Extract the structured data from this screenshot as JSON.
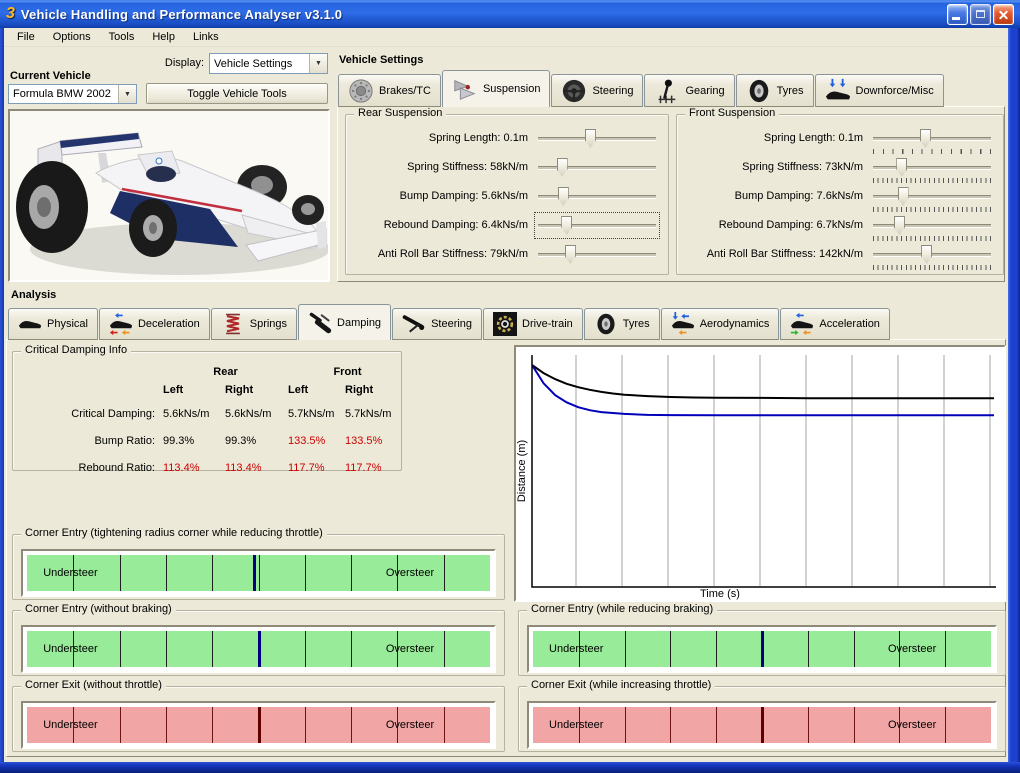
{
  "window": {
    "title": "Vehicle Handling and Performance Analyser v3.1.0",
    "icon_glyph": "3"
  },
  "menu": {
    "items": [
      "File",
      "Options",
      "Tools",
      "Help",
      "Links"
    ]
  },
  "icons": {
    "combo_chevron": "▼"
  },
  "toolbar": {
    "display_label": "Display:",
    "display_value": "Vehicle Settings"
  },
  "current_vehicle": {
    "label": "Current Vehicle",
    "value": "Formula BMW 2002",
    "toggle_button_label": "Toggle Vehicle Tools"
  },
  "vehicle_settings": {
    "section_label": "Vehicle Settings",
    "tabs": [
      {
        "label": "Brakes/TC",
        "icon": "brake-disc-icon",
        "selected": false
      },
      {
        "label": "Suspension",
        "icon": "suspension-icon",
        "selected": true
      },
      {
        "label": "Steering",
        "icon": "steering-wheel-icon",
        "selected": false
      },
      {
        "label": "Gearing",
        "icon": "gear-shifter-icon",
        "selected": false
      },
      {
        "label": "Tyres",
        "icon": "tyre-icon",
        "selected": false
      },
      {
        "label": "Downforce/Misc",
        "icon": "downforce-arrows-icon",
        "selected": false
      }
    ],
    "rear_suspension": {
      "title": "Rear Suspension",
      "sliders": [
        {
          "label": "Spring Length: 0.1m",
          "pct": 44,
          "ticks": 0,
          "focused": false
        },
        {
          "label": "Spring Stiffness: 58kN/m",
          "pct": 20,
          "ticks": 0,
          "focused": false
        },
        {
          "label": "Bump Damping: 5.6kNs/m",
          "pct": 21,
          "ticks": 0,
          "focused": false
        },
        {
          "label": "Rebound Damping: 6.4kNs/m",
          "pct": 24,
          "ticks": 0,
          "focused": true
        },
        {
          "label": "Anti Roll Bar Stiffness: 79kN/m",
          "pct": 27,
          "ticks": 0,
          "focused": false
        }
      ]
    },
    "front_suspension": {
      "title": "Front Suspension",
      "sliders": [
        {
          "label": "Spring Length: 0.1m",
          "pct": 44,
          "ticks": 13,
          "focused": false
        },
        {
          "label": "Spring Stiffness: 73kN/m",
          "pct": 24,
          "ticks": 26,
          "focused": false
        },
        {
          "label": "Bump Damping: 7.6kNs/m",
          "pct": 25,
          "ticks": 26,
          "focused": false
        },
        {
          "label": "Rebound Damping: 6.7kNs/m",
          "pct": 22,
          "ticks": 26,
          "focused": false
        },
        {
          "label": "Anti Roll Bar Stiffness: 142kN/m",
          "pct": 45,
          "ticks": 26,
          "focused": false
        }
      ]
    }
  },
  "analysis": {
    "section_label": "Analysis",
    "tabs": [
      {
        "label": "Physical",
        "icon": "car-silhouette-icon",
        "selected": false
      },
      {
        "label": "Deceleration",
        "icon": "deceleration-arrows-icon",
        "selected": false
      },
      {
        "label": "Springs",
        "icon": "spring-coil-icon",
        "selected": false
      },
      {
        "label": "Damping",
        "icon": "damper-icon",
        "selected": true
      },
      {
        "label": "Steering",
        "icon": "steering-linkage-icon",
        "selected": false
      },
      {
        "label": "Drive-train",
        "icon": "drivetrain-gear-icon",
        "selected": false
      },
      {
        "label": "Tyres",
        "icon": "tyre-icon",
        "selected": false
      },
      {
        "label": "Aerodynamics",
        "icon": "aero-arrows-icon",
        "selected": false
      },
      {
        "label": "Acceleration",
        "icon": "acceleration-arrows-icon",
        "selected": false
      }
    ],
    "critical_damping": {
      "title": "Critical Damping Info",
      "group_headers": [
        "Rear",
        "Front"
      ],
      "col_headers": [
        "Left",
        "Right",
        "Left",
        "Right"
      ],
      "rows": [
        {
          "label": "Critical Damping:",
          "values": [
            "5.6kNs/m",
            "5.6kNs/m",
            "5.7kNs/m",
            "5.7kNs/m"
          ],
          "red": [
            false,
            false,
            false,
            false
          ]
        },
        {
          "label": "Bump Ratio:",
          "values": [
            "99.3%",
            "99.3%",
            "133.5%",
            "133.5%"
          ],
          "red": [
            false,
            false,
            true,
            true
          ]
        },
        {
          "label": "Rebound Ratio:",
          "values": [
            "113.4%",
            "113.4%",
            "117.7%",
            "117.7%"
          ],
          "red": [
            true,
            true,
            true,
            true
          ]
        }
      ]
    },
    "gauges": {
      "left": [
        {
          "title": "Corner Entry (tightening radius corner while reducing throttle)",
          "color_key": "green",
          "marker_pct": 49,
          "left_label": "Understeer",
          "right_label": "Oversteer"
        },
        {
          "title": "Corner Entry (without braking)",
          "color_key": "green",
          "marker_pct": 50,
          "left_label": "Understeer",
          "right_label": "Oversteer"
        },
        {
          "title": "Corner Exit (without throttle)",
          "color_key": "red",
          "marker_pct": 50,
          "left_label": "Understeer",
          "right_label": "Oversteer"
        }
      ],
      "right": [
        {
          "title": "Corner Entry (while reducing braking)",
          "color_key": "green",
          "marker_pct": 50,
          "left_label": "Understeer",
          "right_label": "Oversteer"
        },
        {
          "title": "Corner Exit (while increasing throttle)",
          "color_key": "red",
          "marker_pct": 50,
          "left_label": "Understeer",
          "right_label": "Oversteer"
        }
      ]
    }
  },
  "chart_data": {
    "type": "line",
    "title": "",
    "xlabel": "Time (s)",
    "ylabel": "Distance (m)",
    "xlim": [
      0,
      10
    ],
    "ylim": [
      0,
      1
    ],
    "gridlines": "vertical-only",
    "tick_labels_visible": false,
    "legend": "none",
    "series": [
      {
        "name": "damping-response-1",
        "color": "#000000",
        "x": [
          0,
          0.25,
          0.5,
          0.75,
          1,
          1.25,
          1.5,
          1.75,
          2,
          2.5,
          3,
          3.5,
          4,
          5,
          6,
          10
        ],
        "y": [
          0.957,
          0.922,
          0.896,
          0.876,
          0.861,
          0.85,
          0.841,
          0.834,
          0.829,
          0.823,
          0.819,
          0.817,
          0.816,
          0.815,
          0.814,
          0.814
        ]
      },
      {
        "name": "damping-response-2",
        "color": "#0000BB",
        "x": [
          0,
          0.25,
          0.5,
          0.75,
          1,
          1.25,
          1.5,
          1.75,
          2,
          2.5,
          3,
          4,
          10
        ],
        "y": [
          0.957,
          0.878,
          0.827,
          0.796,
          0.775,
          0.762,
          0.754,
          0.75,
          0.746,
          0.742,
          0.741,
          0.74,
          0.74
        ]
      }
    ]
  },
  "colors": {
    "desktop_beige": "#ECE9D8",
    "title_blue": "#2663DE",
    "border_blue": "#1C41CF",
    "gauge_green": "#98EB98",
    "gauge_red": "#F2A5A5",
    "marker_navy": "#000080",
    "marker_maroon": "#600000",
    "value_red": "#CC0000"
  }
}
